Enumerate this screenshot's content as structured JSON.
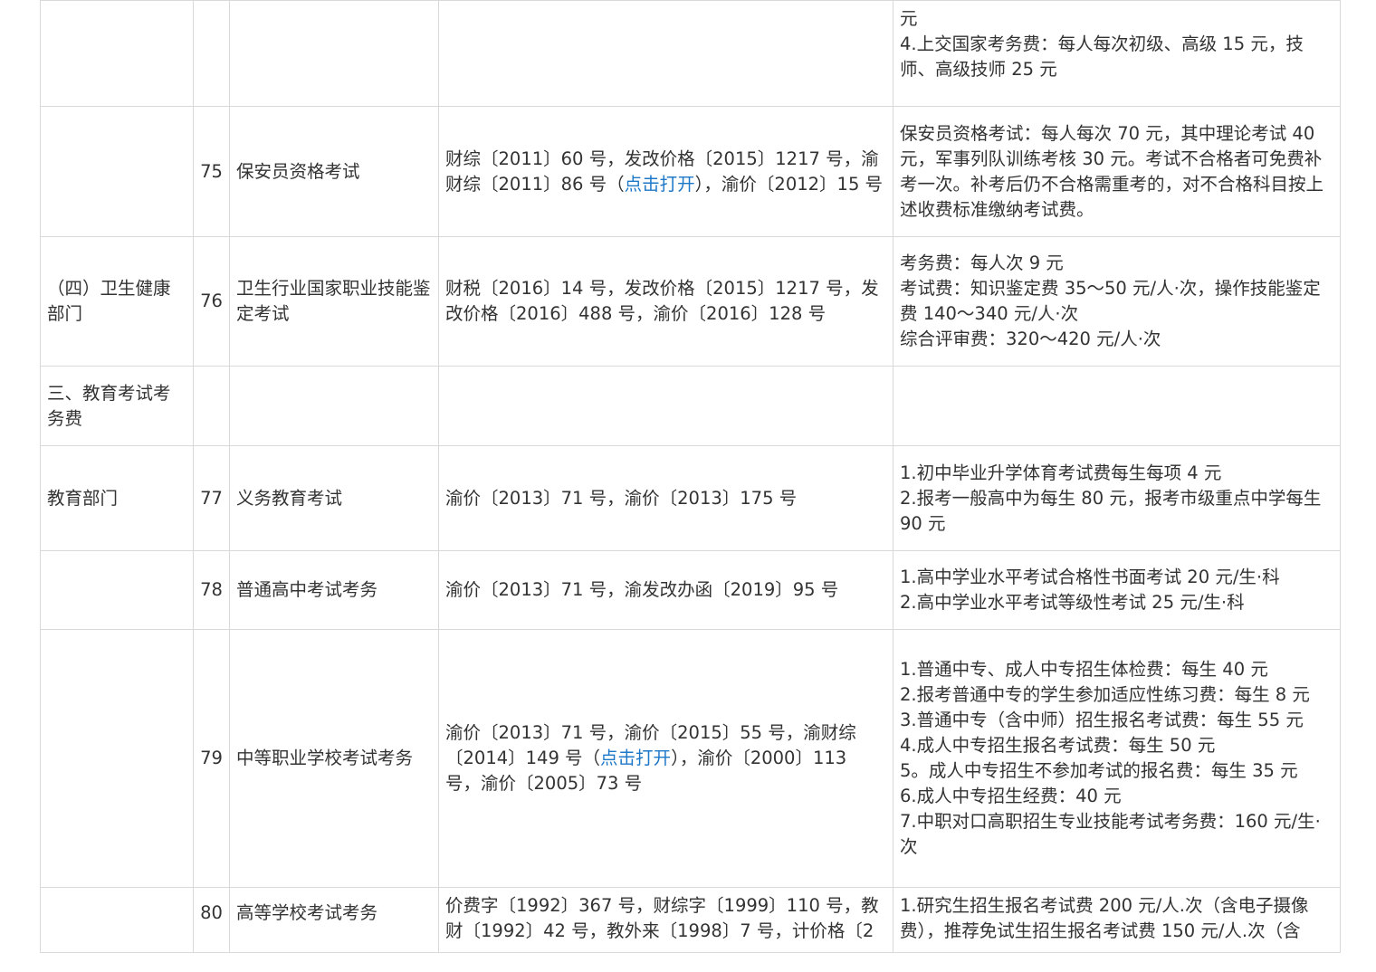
{
  "link_color": "#1e78c8",
  "rows": [
    {
      "category": "",
      "num": "",
      "item": "",
      "basis": [],
      "standard": [
        "元",
        "4.上交国家考务费：每人每次初级、高级 15 元，技师、高级技师 25 元"
      ]
    },
    {
      "category": "",
      "num": "75",
      "item": "保安员资格考试",
      "basis": [
        {
          "text": "财综〔2011〕60 号，发改价格〔2015〕1217 号，渝财综〔2011〕86 号（",
          "link": false
        },
        {
          "text": "点击打开",
          "link": true
        },
        {
          "text": "），渝价〔2012〕15 号",
          "link": false
        }
      ],
      "standard": [
        "保安员资格考试：每人每次 70 元，其中理论考试 40 元，军事列队训练考核 30 元。考试不合格者可免费补考一次。补考后仍不合格需重考的，对不合格科目按上述收费标准缴纳考试费。"
      ]
    },
    {
      "category": "（四）卫生健康部门",
      "num": "76",
      "item": "卫生行业国家职业技能鉴定考试",
      "basis": [
        {
          "text": "财税〔2016〕14 号，发改价格〔2015〕1217 号，发改价格〔2016〕488 号，渝价〔2016〕128 号",
          "link": false
        }
      ],
      "standard": [
        "考务费：每人次 9 元",
        "考试费：知识鉴定费 35～50 元/人·次，操作技能鉴定费 140～340 元/人·次",
        "综合评审费：320～420 元/人·次"
      ]
    },
    {
      "category": "三、教育考试考务费",
      "num": "",
      "item": "",
      "basis": [],
      "standard": []
    },
    {
      "category": "教育部门",
      "num": "77",
      "item": "义务教育考试",
      "basis": [
        {
          "text": "渝价〔2013〕71 号，渝价〔2013〕175 号",
          "link": false
        }
      ],
      "standard": [
        "1.初中毕业升学体育考试费每生每项 4 元",
        "2.报考一般高中为每生 80 元，报考市级重点中学每生 90 元"
      ]
    },
    {
      "category": "",
      "num": "78",
      "item": "普通高中考试考务",
      "basis": [
        {
          "text": "渝价〔2013〕71 号，渝发改办函〔2019〕95 号",
          "link": false
        }
      ],
      "standard": [
        "1.高中学业水平考试合格性书面考试 20 元/生·科",
        "2.高中学业水平考试等级性考试 25 元/生·科"
      ]
    },
    {
      "category": "",
      "num": "79",
      "item": "中等职业学校考试考务",
      "basis": [
        {
          "text": "渝价〔2013〕71 号，渝价〔2015〕55 号，渝财综〔2014〕149 号（",
          "link": false
        },
        {
          "text": "点击打开",
          "link": true
        },
        {
          "text": "），渝价〔2000〕113 号，渝价〔2005〕73 号",
          "link": false
        }
      ],
      "standard": [
        "1.普通中专、成人中专招生体检费：每生 40 元",
        "2.报考普通中专的学生参加适应性练习费：每生 8 元",
        "3.普通中专（含中师）招生报名考试费：每生 55 元",
        "4.成人中专招生报名考试费：每生 50 元",
        "5。成人中专招生不参加考试的报名费：每生 35 元",
        "6.成人中专招生经费：40 元",
        "7.中职对口高职招生专业技能考试考务费：160 元/生·次"
      ]
    },
    {
      "category": "",
      "num": "80",
      "item": "高等学校考试考务",
      "basis": [
        {
          "text": "价费字〔1992〕367 号，财综字〔1999〕110 号，教财〔1992〕42 号，教外来〔1998〕7 号，计价格〔2",
          "link": false
        }
      ],
      "standard": [
        "1.研究生招生报名考试费 200 元/人.次（含电子摄像费），推荐免试生招生报名考试费 150 元/人.次（含"
      ]
    }
  ]
}
